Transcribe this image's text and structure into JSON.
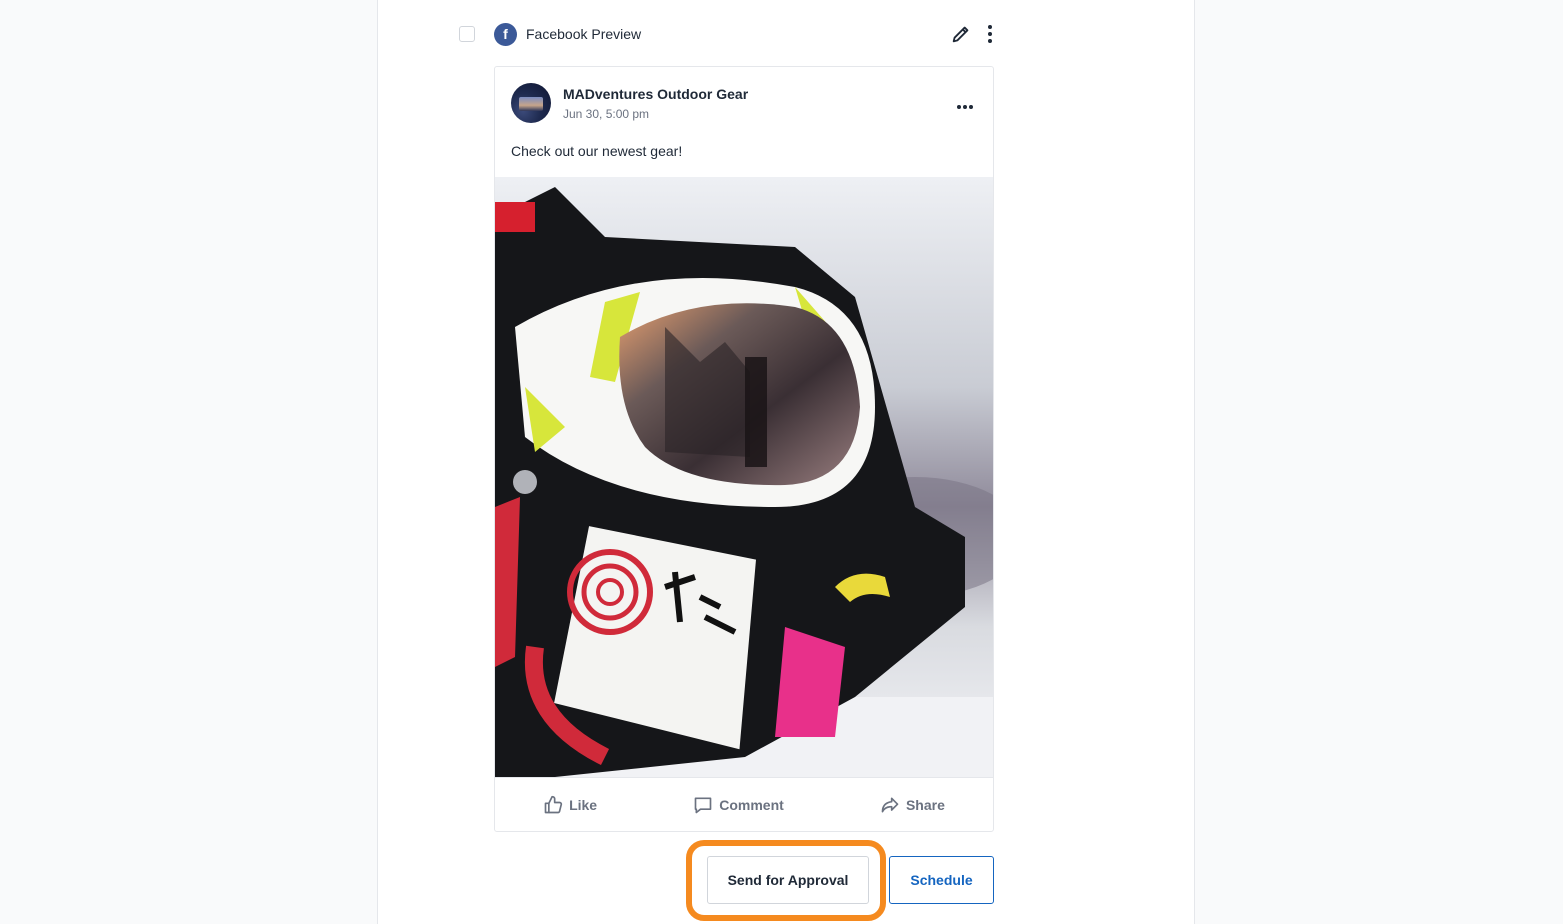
{
  "preview": {
    "label": "Facebook Preview",
    "platform_icon": "facebook-icon",
    "platform_letter": "f",
    "brand_color": "#3b5998"
  },
  "post": {
    "page_name": "MADventures Outdoor Gear",
    "date": "Jun 30, 5:00 pm",
    "text": "Check out our newest gear!",
    "image_subject": "ski helmet with mirrored goggles in snow",
    "actions": [
      {
        "label": "Like",
        "icon": "thumbs-up-icon"
      },
      {
        "label": "Comment",
        "icon": "comment-icon"
      },
      {
        "label": "Share",
        "icon": "share-icon"
      }
    ]
  },
  "footer": {
    "approval_label": "Send for Approval",
    "schedule_label": "Schedule",
    "highlight_color": "#f58a1f",
    "schedule_color": "#1565c0"
  }
}
